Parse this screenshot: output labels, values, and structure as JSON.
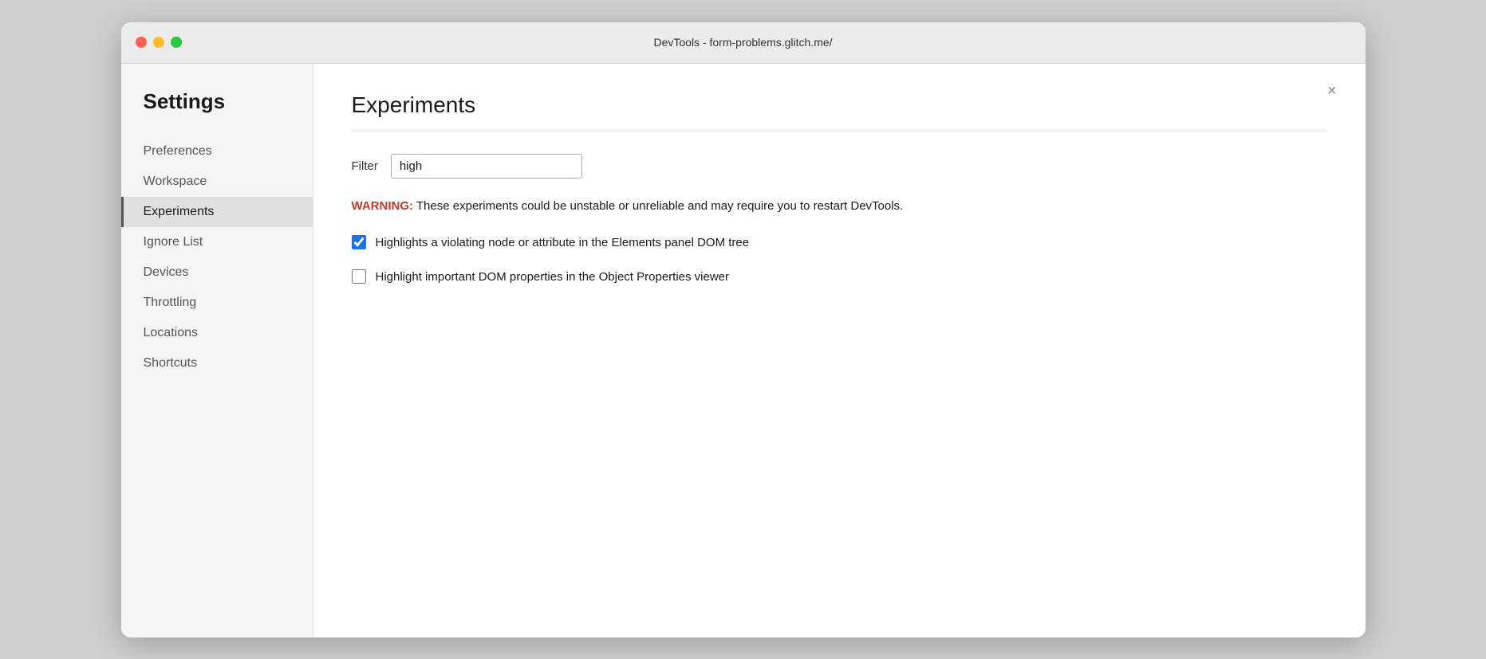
{
  "titlebar": {
    "title": "DevTools - form-problems.glitch.me/"
  },
  "sidebar": {
    "heading": "Settings",
    "items": [
      {
        "id": "preferences",
        "label": "Preferences",
        "active": false
      },
      {
        "id": "workspace",
        "label": "Workspace",
        "active": false
      },
      {
        "id": "experiments",
        "label": "Experiments",
        "active": true
      },
      {
        "id": "ignore-list",
        "label": "Ignore List",
        "active": false
      },
      {
        "id": "devices",
        "label": "Devices",
        "active": false
      },
      {
        "id": "throttling",
        "label": "Throttling",
        "active": false
      },
      {
        "id": "locations",
        "label": "Locations",
        "active": false
      },
      {
        "id": "shortcuts",
        "label": "Shortcuts",
        "active": false
      }
    ]
  },
  "main": {
    "title": "Experiments",
    "close_button": "×",
    "filter": {
      "label": "Filter",
      "value": "high",
      "placeholder": ""
    },
    "warning": {
      "prefix": "WARNING:",
      "message": " These experiments could be unstable or unreliable and may require you to restart DevTools."
    },
    "experiments": [
      {
        "id": "exp1",
        "label": "Highlights a violating node or attribute in the Elements panel DOM tree",
        "checked": true
      },
      {
        "id": "exp2",
        "label": "Highlight important DOM properties in the Object Properties viewer",
        "checked": false
      }
    ]
  },
  "colors": {
    "warning_red": "#c0392b",
    "checkbox_blue": "#1a73e8",
    "active_sidebar_indicator": "#555555"
  }
}
